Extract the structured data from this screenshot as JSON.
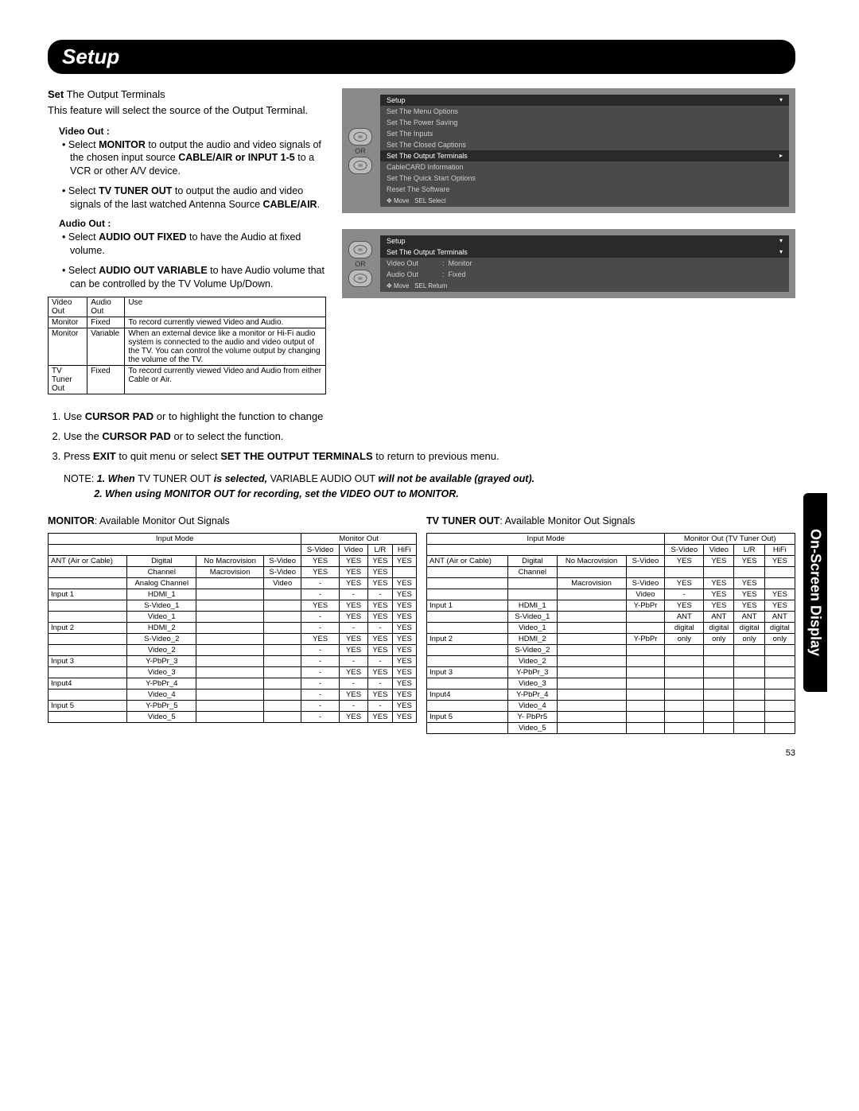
{
  "header": {
    "title": "Setup"
  },
  "side_tab": "On-Screen Display",
  "page_number": "53",
  "intro": {
    "title_bold": "Set",
    "title_rest": " The Output Terminals",
    "body": "This feature will select the source of the Output Terminal."
  },
  "video_out": {
    "label": "Video Out :",
    "b1_pre": "Select ",
    "b1_bold": "MONITOR",
    "b1_mid": " to output the audio and video signals of the chosen input source ",
    "b1_bold2": "CABLE/AIR or INPUT 1-5",
    "b1_post": " to a VCR or other A/V device.",
    "b2_pre": "Select ",
    "b2_bold": "TV TUNER OUT",
    "b2_mid": " to output the audio and video signals of the last watched Antenna Source ",
    "b2_bold2": "CABLE/AIR",
    "b2_post": "."
  },
  "audio_out": {
    "label": "Audio Out :",
    "b1_pre": "Select ",
    "b1_bold": "AUDIO OUT FIXED",
    "b1_post": " to have the Audio at fixed volume.",
    "b2_pre": "Select ",
    "b2_bold": "AUDIO OUT VARIABLE",
    "b2_post": " to have Audio volume that can be controlled by the TV Volume Up/Down."
  },
  "use_table": {
    "h1": "Video Out",
    "h2": "Audio Out",
    "h3": "Use",
    "r1c1": "Monitor",
    "r1c2": "Fixed",
    "r1c3": "To record currently viewed Video and Audio.",
    "r2c1": "Monitor",
    "r2c2": "Variable",
    "r2c3": "When an external device like a monitor or Hi-Fi audio system is connected to the audio and video output of the TV. You can control the volume output by changing the volume of the TV.",
    "r3c1": "TV Tuner Out",
    "r3c2": "Fixed",
    "r3c3": "To record currently viewed Video and Audio from either Cable or Air."
  },
  "osd1": {
    "or": "OR",
    "title": "Setup",
    "i1": "Set The Menu Options",
    "i2": "Set The Power Saving",
    "i3": "Set The Inputs",
    "i4": "Set The Closed Captions",
    "i5": "Set The Output Terminals",
    "i6": "CableCARD Information",
    "i7": "Set The Quick Start Options",
    "i8": "Reset The Software",
    "footer_move": "Move",
    "footer_sel": "SEL Select"
  },
  "osd2": {
    "or": "OR",
    "title": "Setup",
    "sub": "Set The Output Terminals",
    "r1a": "Video Out",
    "r1b": ":",
    "r1c": "Monitor",
    "r2a": "Audio Out",
    "r2b": ":",
    "r2c": "Fixed",
    "footer_move": "Move",
    "footer_sel": "SEL Return"
  },
  "steps": {
    "s1a": "Use ",
    "s1b": "CURSOR PAD",
    "s1c": "    or    to highlight the function to change",
    "s2a": "Use the ",
    "s2b": "CURSOR PAD",
    "s2c": "    or    to select the function.",
    "s3a": "Press ",
    "s3b": "EXIT",
    "s3c": " to quit menu or select ",
    "s3d": "SET THE OUTPUT TERMINALS",
    "s3e": "  to return to previous menu."
  },
  "note": {
    "label": "NOTE:",
    "n1a": "1.   When ",
    "n1b": "TV TUNER OUT",
    "n1c": " is selected, ",
    "n1d": "VARIABLE AUDIO OUT",
    "n1e": " will not be available (grayed out).",
    "n2": "2.   When using MONITOR OUT for recording, set the VIDEO OUT to MONITOR."
  },
  "sig_monitor": {
    "title_bold": "MONITOR",
    "title_rest": ": Available Monitor Out Signals",
    "grp_input": "Input Mode",
    "grp_out": "Monitor Out",
    "c_sv": "S-Video",
    "c_v": "Video",
    "c_lr": "L/R",
    "c_hf": "HiFi",
    "rows": [
      {
        "g": "ANT (Air or Cable)",
        "a": "Digital",
        "b": "No Macrovision",
        "c": "S-Video",
        "sv": "YES",
        "v": "YES",
        "lr": "YES",
        "hf": "YES"
      },
      {
        "g": "",
        "a": "Channel",
        "b": "Macrovision",
        "c": "S-Video",
        "sv": "YES",
        "v": "YES",
        "lr": "YES",
        "hf": ""
      },
      {
        "g": "",
        "a": "Analog Channel",
        "b": "",
        "c": "Video",
        "sv": "-",
        "v": "YES",
        "lr": "YES",
        "hf": "YES"
      },
      {
        "g": "Input 1",
        "a": "HDMI_1",
        "b": "",
        "c": "",
        "sv": "-",
        "v": "-",
        "lr": "-",
        "hf": "YES"
      },
      {
        "g": "",
        "a": "S-Video_1",
        "b": "",
        "c": "",
        "sv": "YES",
        "v": "YES",
        "lr": "YES",
        "hf": "YES"
      },
      {
        "g": "",
        "a": "Video_1",
        "b": "",
        "c": "",
        "sv": "-",
        "v": "YES",
        "lr": "YES",
        "hf": "YES"
      },
      {
        "g": "Input 2",
        "a": "HDMI_2",
        "b": "",
        "c": "",
        "sv": "-",
        "v": "-",
        "lr": "-",
        "hf": "YES"
      },
      {
        "g": "",
        "a": "S-Video_2",
        "b": "",
        "c": "",
        "sv": "YES",
        "v": "YES",
        "lr": "YES",
        "hf": "YES"
      },
      {
        "g": "",
        "a": "Video_2",
        "b": "",
        "c": "",
        "sv": "-",
        "v": "YES",
        "lr": "YES",
        "hf": "YES"
      },
      {
        "g": "Input 3",
        "a": "Y-PbPr_3",
        "b": "",
        "c": "",
        "sv": "-",
        "v": "-",
        "lr": "-",
        "hf": "YES"
      },
      {
        "g": "",
        "a": "Video_3",
        "b": "",
        "c": "",
        "sv": "-",
        "v": "YES",
        "lr": "YES",
        "hf": "YES"
      },
      {
        "g": "Input4",
        "a": "Y-PbPr_4",
        "b": "",
        "c": "",
        "sv": "-",
        "v": "-",
        "lr": "-",
        "hf": "YES"
      },
      {
        "g": "",
        "a": "Video_4",
        "b": "",
        "c": "",
        "sv": "-",
        "v": "YES",
        "lr": "YES",
        "hf": "YES"
      },
      {
        "g": "Input 5",
        "a": "Y-PbPr_5",
        "b": "",
        "c": "",
        "sv": "-",
        "v": "-",
        "lr": "-",
        "hf": "YES"
      },
      {
        "g": "",
        "a": "Video_5",
        "b": "",
        "c": "",
        "sv": "-",
        "v": "YES",
        "lr": "YES",
        "hf": "YES"
      }
    ]
  },
  "sig_tuner": {
    "title_bold": "TV TUNER OUT",
    "title_rest": ": Available Monitor Out Signals",
    "grp_input": "Input Mode",
    "grp_out": "Monitor Out (TV Tuner Out)",
    "c_sv": "S-Video",
    "c_v": "Video",
    "c_lr": "L/R",
    "c_hf": "HiFi",
    "rows": [
      {
        "g": "ANT (Air or Cable)",
        "a": "Digital",
        "b": "No Macrovision",
        "c": "S-Video",
        "sv": "YES",
        "v": "YES",
        "lr": "YES",
        "hf": "YES"
      },
      {
        "g": "",
        "a": "Channel",
        "b": "",
        "c": "",
        "sv": "",
        "v": "",
        "lr": "",
        "hf": ""
      },
      {
        "g": "",
        "a": "",
        "b": "Macrovision",
        "c": "S-Video",
        "sv": "YES",
        "v": "YES",
        "lr": "YES",
        "hf": ""
      },
      {
        "g": "",
        "a": "",
        "b": "",
        "c": "Video",
        "sv": "-",
        "v": "YES",
        "lr": "YES",
        "hf": "YES"
      },
      {
        "g": "Input 1",
        "a": "HDMI_1",
        "b": "",
        "c": "Y-PbPr",
        "sv": "YES",
        "v": "YES",
        "lr": "YES",
        "hf": "YES"
      },
      {
        "g": "",
        "a": "S-Video_1",
        "b": "",
        "c": "",
        "sv": "ANT",
        "v": "ANT",
        "lr": "ANT",
        "hf": "ANT"
      },
      {
        "g": "",
        "a": "Video_1",
        "b": "",
        "c": "",
        "sv": "digital",
        "v": "digital",
        "lr": "digital",
        "hf": "digital"
      },
      {
        "g": "Input 2",
        "a": "HDMI_2",
        "b": "",
        "c": "Y-PbPr",
        "sv": "only",
        "v": "only",
        "lr": "only",
        "hf": "only"
      },
      {
        "g": "",
        "a": "S-Video_2",
        "b": "",
        "c": "",
        "sv": "",
        "v": "",
        "lr": "",
        "hf": ""
      },
      {
        "g": "",
        "a": "Video_2",
        "b": "",
        "c": "",
        "sv": "",
        "v": "",
        "lr": "",
        "hf": ""
      },
      {
        "g": "Input 3",
        "a": "Y-PbPr_3",
        "b": "",
        "c": "",
        "sv": "",
        "v": "",
        "lr": "",
        "hf": ""
      },
      {
        "g": "",
        "a": "Video_3",
        "b": "",
        "c": "",
        "sv": "",
        "v": "",
        "lr": "",
        "hf": ""
      },
      {
        "g": "Input4",
        "a": "Y-PbPr_4",
        "b": "",
        "c": "",
        "sv": "",
        "v": "",
        "lr": "",
        "hf": ""
      },
      {
        "g": "",
        "a": "Video_4",
        "b": "",
        "c": "",
        "sv": "",
        "v": "",
        "lr": "",
        "hf": ""
      },
      {
        "g": "Input 5",
        "a": "Y- PbPr5",
        "b": "",
        "c": "",
        "sv": "",
        "v": "",
        "lr": "",
        "hf": ""
      },
      {
        "g": "",
        "a": "Video_5",
        "b": "",
        "c": "",
        "sv": "",
        "v": "",
        "lr": "",
        "hf": ""
      }
    ]
  }
}
